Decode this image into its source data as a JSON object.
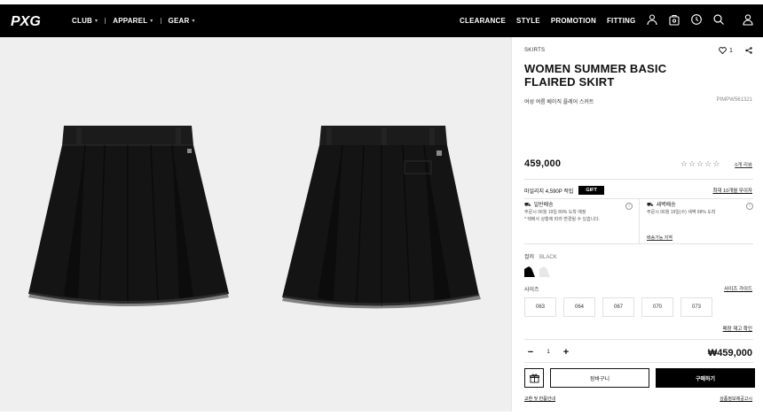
{
  "header": {
    "logo_text": "PXG",
    "nav_left": [
      {
        "label": "CLUB"
      },
      {
        "label": "APPAREL"
      },
      {
        "label": "GEAR"
      }
    ],
    "nav_right": [
      {
        "label": "CLEARANCE"
      },
      {
        "label": "STYLE"
      },
      {
        "label": "PROMOTION"
      },
      {
        "label": "FITTING"
      }
    ],
    "icons": [
      "user-icon",
      "store-icon",
      "history-icon",
      "search-icon",
      "account-icon"
    ]
  },
  "gallery": {
    "background": "#efefef",
    "skirt_color": "#161616"
  },
  "product": {
    "category": "SKIRTS",
    "likes": "1",
    "title": "WOMEN SUMMER BASIC FLAIRED SKIRT",
    "subname": "여성 여름 베이직 플레어 스커트",
    "code": "PIMPW561321",
    "price": "459,000",
    "rating_stars": 0,
    "reviews_link": "0개 리뷰",
    "mileage": "마일리지 4,590P 적립",
    "gift_badge": "GIFT",
    "coupon_link": "최대 10개월 무이자",
    "shipping": {
      "normal_title": "일반배송",
      "normal_line1": "주문시 06월 19일 89% 도착 예정",
      "normal_line2": "* 택배사 상황에 따라 변경될 수 있습니다.",
      "dawn_title": "새벽배송",
      "dawn_line1": "주문시 06월 19일(수) 새벽 98% 도착",
      "area_link": "배송가능 지역"
    },
    "color_label": "컬러",
    "color_value": "BLACK",
    "colors": [
      "#000000",
      "#e8e8e8"
    ],
    "size_label": "사이즈",
    "size_guide": "사이즈 가이드",
    "sizes": [
      "063",
      "064",
      "067",
      "070",
      "073"
    ],
    "stock_link": "매장 재고 확인",
    "quantity": "1",
    "qty_minus": "−",
    "qty_plus": "+",
    "total": "₩459,000",
    "cart_label": "장바구니",
    "buy_label": "구매하기",
    "exchange_link": "교환 및 반품안내",
    "guide_link": "상품정보제공고시"
  },
  "colors": {
    "brand": "#000000",
    "accent": "#ffffff"
  }
}
